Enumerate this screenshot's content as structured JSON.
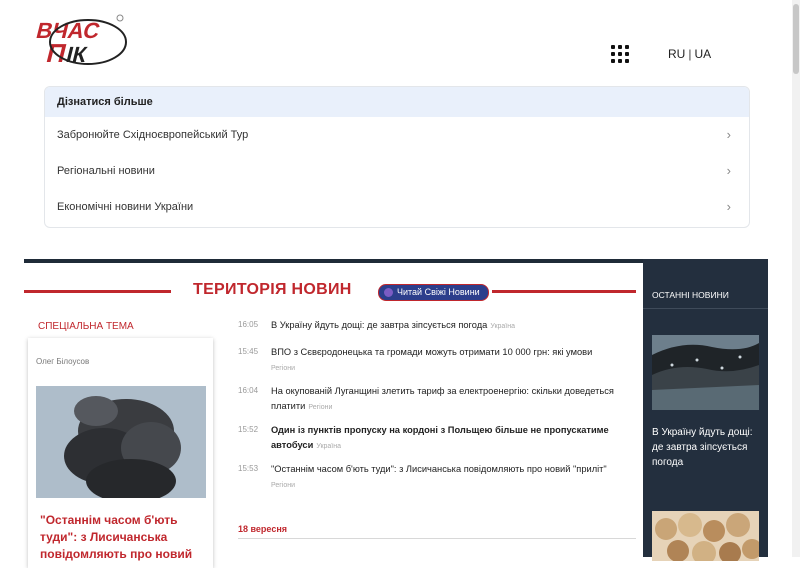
{
  "header": {
    "logo_text": "ВЧАС ПІК",
    "lang": {
      "ru": "RU",
      "ua": "UA"
    }
  },
  "adbox": {
    "title": "Дізнатися більше",
    "items": [
      {
        "label": "Забронюйте Східноєвропейський Тур"
      },
      {
        "label": "Регіональні новини"
      },
      {
        "label": "Економічні новини України"
      }
    ]
  },
  "section": {
    "title": "ТЕРИТОРІЯ НОВИН",
    "viber_label": "Читай Свіжі Новини"
  },
  "special": {
    "label": "СПЕЦІАЛЬНА ТЕМА",
    "author": "Олег Білоусов",
    "title": "\"Останнім часом б'ють туди\": з Лисичанська повідомляють про новий"
  },
  "news": [
    {
      "time": "16:05",
      "text": "В Україну йдуть дощі: де завтра зіпсується погода",
      "tag": "Україна",
      "bold": false
    },
    {
      "time": "15:45",
      "text": "ВПО з Сєвєродонецька та громади можуть отримати 10 000 грн: які умови",
      "tag": "Регіони",
      "bold": false
    },
    {
      "time": "16:04",
      "text": "На окупованій Луганщині злетить тариф за електроенергію: скільки доведеться платити",
      "tag": "Регіони",
      "bold": false
    },
    {
      "time": "15:52",
      "text": "Один із пунктів пропуску на кордоні з Польщею більше не пропускатиме автобуси",
      "tag": "Україна",
      "bold": true
    },
    {
      "time": "15:53",
      "text": "\"Останнім часом б'ють туди\": з Лисичанська повідомляють про новий \"приліт\"",
      "tag": "Регіони",
      "bold": false
    }
  ],
  "date_heading": "18 вересня",
  "sidebar": {
    "label": "ОСТАННІ НОВИНИ",
    "story_title": "В Україну йдуть дощі: де завтра зіпсується погода"
  },
  "colors": {
    "accent_red": "#c0272d",
    "dark_navy": "#232f3e",
    "viber_blue": "#2c3e8c"
  }
}
